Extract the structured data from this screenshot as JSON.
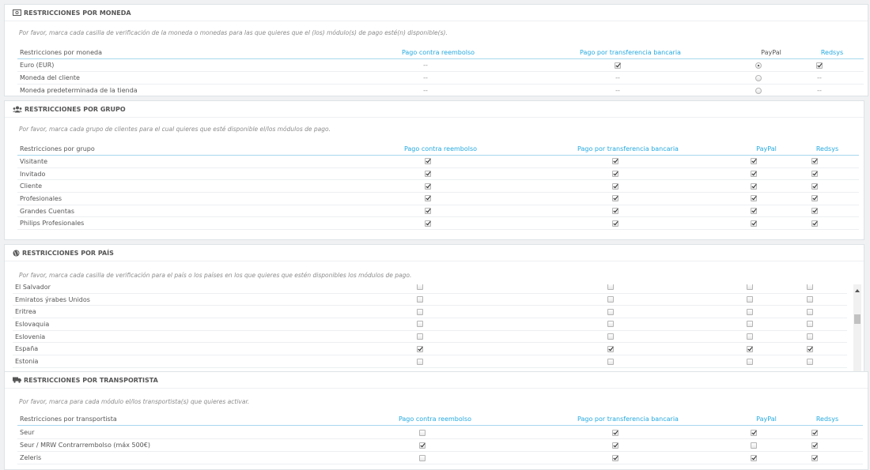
{
  "columns": [
    "Pago contra reembolso",
    "Pago por transferencia bancaria",
    "PayPal",
    "Redsys"
  ],
  "moneda": {
    "title": "RESTRICCIONES POR MONEDA",
    "icon": "money-icon",
    "help": "Por favor, marca cada casilla de verificación de la moneda o monedas para las que quieres que el (los) módulo(s) de pago esté(n) disponible(s).",
    "header": "Restricciones por moneda",
    "dash": "--",
    "rows": [
      {
        "label": "Euro (EUR)",
        "cells": [
          "dash",
          "on",
          "radio-on",
          "on"
        ]
      },
      {
        "label": "Moneda del cliente",
        "cells": [
          "dash",
          "dash",
          "radio",
          "dash"
        ]
      },
      {
        "label": "Moneda predeterminada de la tienda",
        "cells": [
          "dash",
          "dash",
          "radio",
          "dash"
        ]
      }
    ]
  },
  "grupo": {
    "title": "RESTRICCIONES POR GRUPO",
    "icon": "group-icon",
    "help": "Por favor, marca cada grupo de clientes para el cual quieres que esté disponible el/los módulos de pago.",
    "header": "Restricciones por grupo",
    "rows": [
      {
        "label": "Visitante",
        "cells": [
          "on",
          "on",
          "on",
          "on"
        ]
      },
      {
        "label": "Invitado",
        "cells": [
          "on",
          "on",
          "on",
          "on"
        ]
      },
      {
        "label": "Cliente",
        "cells": [
          "on",
          "on",
          "on",
          "on"
        ]
      },
      {
        "label": "Profesionales",
        "cells": [
          "on",
          "on",
          "on",
          "on"
        ]
      },
      {
        "label": "Grandes Cuentas",
        "cells": [
          "on",
          "on",
          "on",
          "on"
        ]
      },
      {
        "label": "Philips Profesionales",
        "cells": [
          "on",
          "on",
          "on",
          "on"
        ]
      }
    ]
  },
  "pais": {
    "title": "RESTRICCIONES POR PAÍS",
    "icon": "globe-icon",
    "help": "Por favor, marca cada casilla de verificación para el país o los países en los que quieres que estén disponibles los módulos de pago.",
    "rows": [
      {
        "label": "El Salvador",
        "cells": [
          "off",
          "off",
          "off",
          "off"
        ]
      },
      {
        "label": "Emiratos ýrabes Unidos",
        "cells": [
          "off",
          "off",
          "off",
          "off"
        ]
      },
      {
        "label": "Eritrea",
        "cells": [
          "off",
          "off",
          "off",
          "off"
        ]
      },
      {
        "label": "Eslovaquia",
        "cells": [
          "off",
          "off",
          "off",
          "off"
        ]
      },
      {
        "label": "Eslovenia",
        "cells": [
          "off",
          "off",
          "off",
          "off"
        ]
      },
      {
        "label": "España",
        "cells": [
          "on",
          "on",
          "on",
          "on"
        ]
      },
      {
        "label": "Estonia",
        "cells": [
          "off",
          "off",
          "off",
          "off"
        ]
      }
    ]
  },
  "transportista": {
    "title": "RESTRICCIONES POR TRANSPORTISTA",
    "icon": "truck-icon",
    "help": "Por favor, marca para cada módulo el/los transportista(s) que quieres activar.",
    "header": "Restricciones por transportista",
    "rows": [
      {
        "label": "Seur",
        "cells": [
          "off",
          "on",
          "on",
          "on"
        ]
      },
      {
        "label": "Seur / MRW Contrarrembolso (máx 500€)",
        "cells": [
          "on",
          "on",
          "off",
          "on"
        ]
      },
      {
        "label": "Zeleris",
        "cells": [
          "off",
          "on",
          "on",
          "on"
        ]
      }
    ]
  }
}
